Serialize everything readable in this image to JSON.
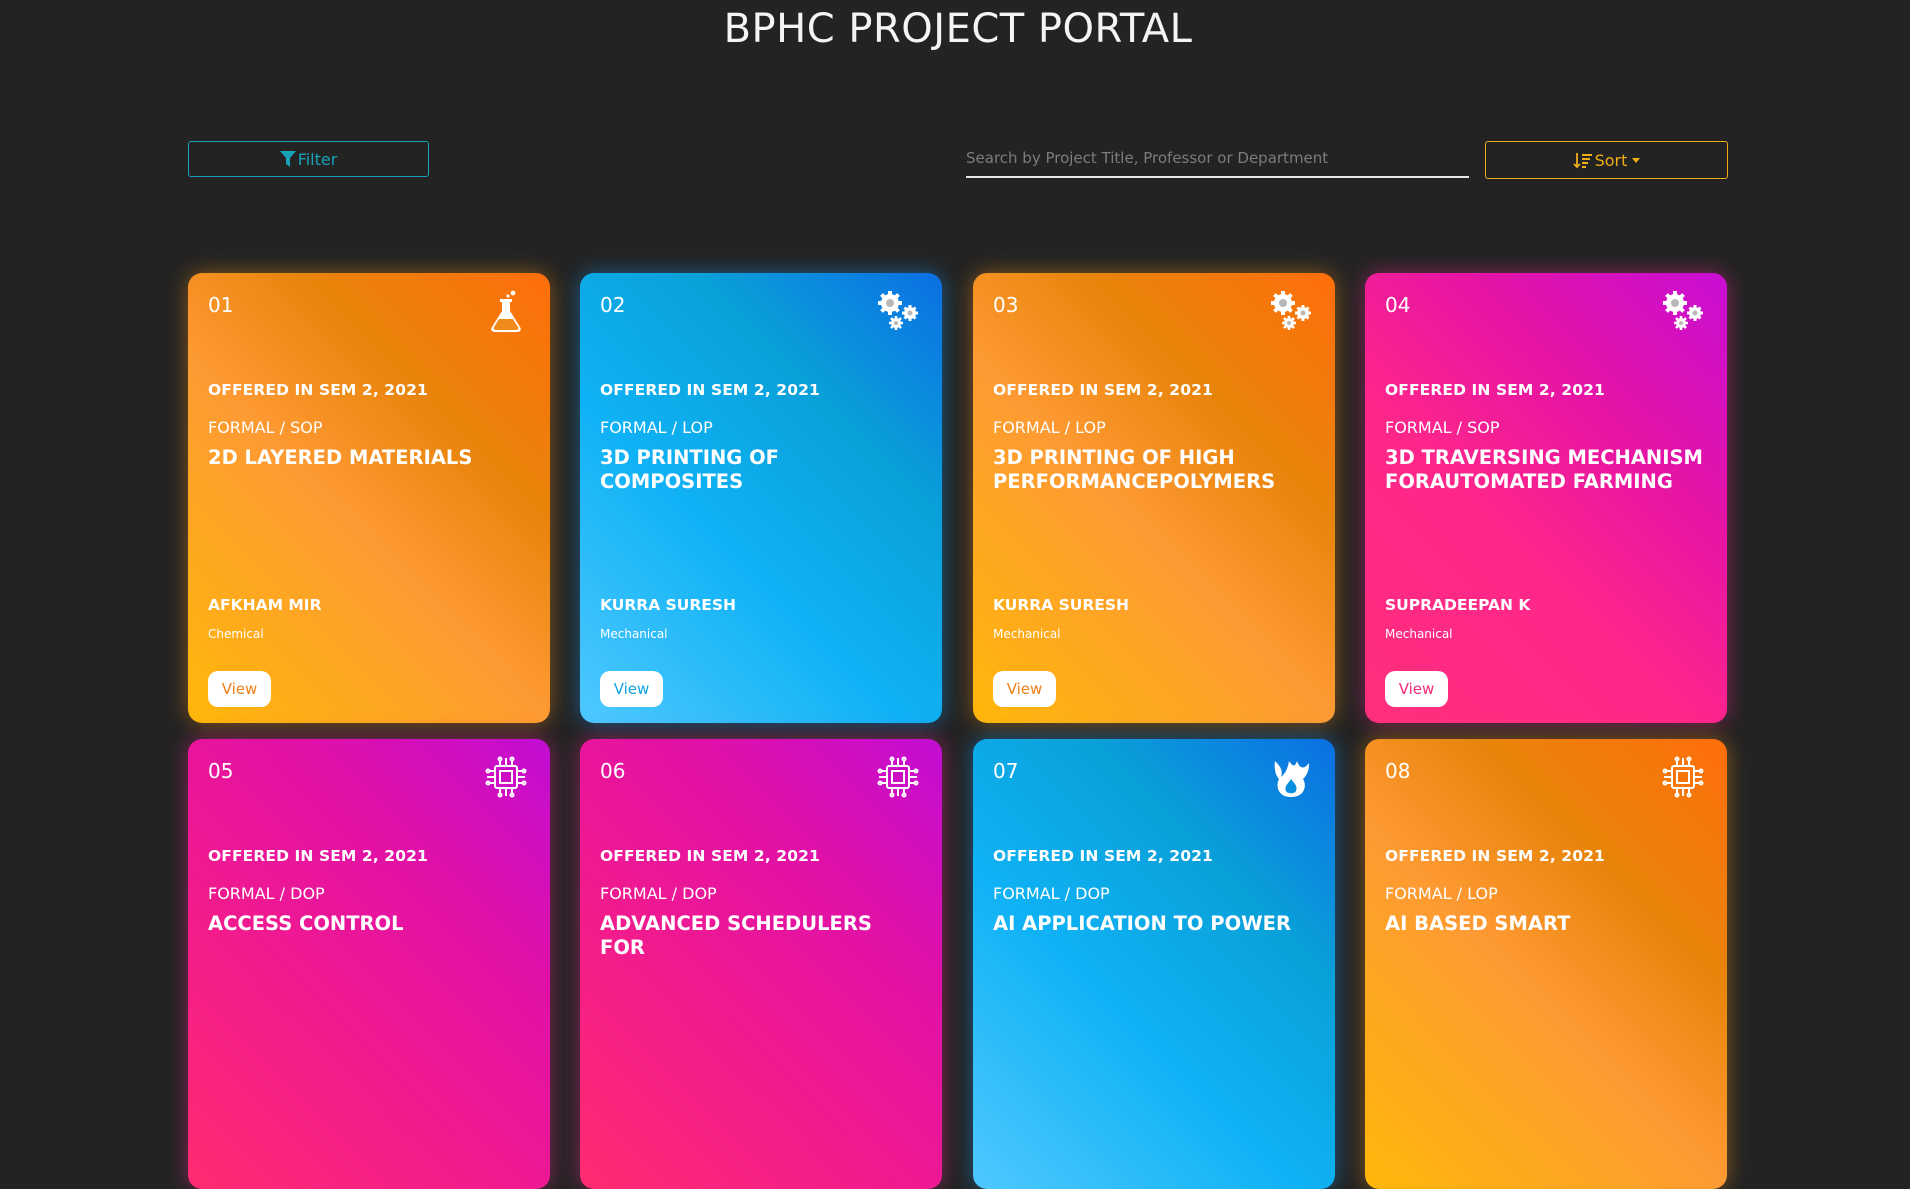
{
  "header": {
    "title": "BPHC PROJECT PORTAL"
  },
  "toolbar": {
    "filter_label": "Filter",
    "search_placeholder": "Search by Project Title, Professor or Department",
    "search_value": "",
    "sort_label": "Sort"
  },
  "cards": [
    {
      "num": "01",
      "offered": "OFFERED IN SEM 2, 2021",
      "type": "FORMAL / SOP",
      "title": "2D LAYERED MATERIALS",
      "professor": "AFKHAM MIR",
      "department": "Chemical",
      "view": "View",
      "icon": "flask-icon",
      "theme": "orange"
    },
    {
      "num": "02",
      "offered": "OFFERED IN SEM 2, 2021",
      "type": "FORMAL / LOP",
      "title": "3D PRINTING OF COMPOSITES",
      "professor": "KURRA SURESH",
      "department": "Mechanical",
      "view": "View",
      "icon": "gears-icon",
      "theme": "blue"
    },
    {
      "num": "03",
      "offered": "OFFERED IN SEM 2, 2021",
      "type": "FORMAL / LOP",
      "title": "3D PRINTING OF HIGH PERFORMANCEPOLYMERS",
      "professor": "KURRA SURESH",
      "department": "Mechanical",
      "view": "View",
      "icon": "gears-icon",
      "theme": "orange"
    },
    {
      "num": "04",
      "offered": "OFFERED IN SEM 2, 2021",
      "type": "FORMAL / SOP",
      "title": "3D TRAVERSING MECHANISM FORAUTOMATED FARMING",
      "professor": "SUPRADEEPAN K",
      "department": "Mechanical",
      "view": "View",
      "icon": "gears-icon",
      "theme": "pink"
    },
    {
      "num": "05",
      "offered": "OFFERED IN SEM 2, 2021",
      "type": "FORMAL / DOP",
      "title": "ACCESS CONTROL",
      "icon": "chip-icon",
      "theme": "pink2"
    },
    {
      "num": "06",
      "offered": "OFFERED IN SEM 2, 2021",
      "type": "FORMAL / DOP",
      "title": "ADVANCED SCHEDULERS FOR",
      "icon": "chip-icon",
      "theme": "pink2"
    },
    {
      "num": "07",
      "offered": "OFFERED IN SEM 2, 2021",
      "type": "FORMAL / DOP",
      "title": "AI APPLICATION TO POWER",
      "icon": "fire-icon",
      "theme": "blue"
    },
    {
      "num": "08",
      "offered": "OFFERED IN SEM 2, 2021",
      "type": "FORMAL / LOP",
      "title": "AI BASED SMART",
      "icon": "chip-icon",
      "theme": "orange"
    }
  ]
}
